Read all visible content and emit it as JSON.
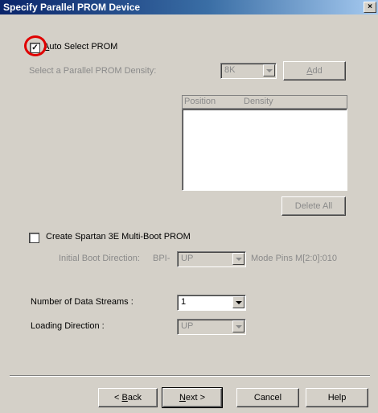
{
  "window": {
    "title": "Specify Parallel PROM Device",
    "close_glyph": "×"
  },
  "auto_select": {
    "label_prefix": "A",
    "label_rest": "uto Select PROM",
    "checked": true,
    "check_glyph": "✓"
  },
  "density": {
    "label": "Select a Parallel PROM Density:",
    "value": "8K",
    "add_prefix": "A",
    "add_rest": "dd"
  },
  "list": {
    "col_position": "Position",
    "col_density": "Density"
  },
  "delete_all": "Delete All",
  "multiboot": {
    "label": "Create Spartan 3E Multi-Boot PROM",
    "checked": false,
    "boot_direction_label": "Initial Boot Direction:",
    "bpi_label": "BPI-",
    "boot_direction_value": "UP",
    "mode_pins": "Mode Pins M[2:0]:010"
  },
  "data_streams": {
    "label": "Number of Data Streams :",
    "value": "1"
  },
  "loading_direction": {
    "label": "Loading Direction :",
    "value": "UP"
  },
  "buttons": {
    "back_pre": "< ",
    "back_key": "B",
    "back_rest": "ack",
    "next_key": "N",
    "next_rest": "ext >",
    "cancel": "Cancel",
    "help": "Help"
  }
}
